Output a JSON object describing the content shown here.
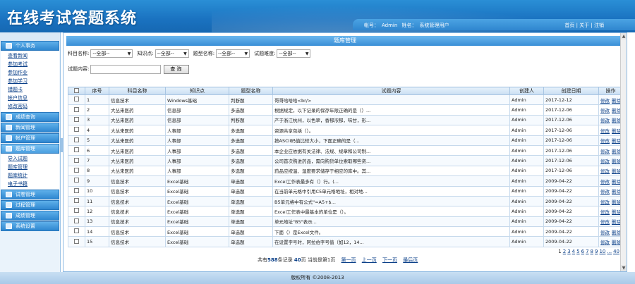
{
  "header": {
    "title": "在线考试答题系统",
    "account_label": "帐号：",
    "account": "Admin",
    "name_label": "姓名：",
    "name": "系统管理用户",
    "home": "首页",
    "about": "关于",
    "logout": "注销",
    "sep": "|"
  },
  "sidebar": {
    "groups": [
      {
        "label": "个人事务",
        "active": false,
        "items": [
          "查看新闻",
          "参加考试",
          "参加作业",
          "参加学习",
          "错题卡",
          "帐户信息",
          "修改密码"
        ]
      },
      {
        "label": "成绩查询",
        "active": false,
        "items": []
      },
      {
        "label": "新闻管理",
        "active": false,
        "items": []
      },
      {
        "label": "帐户管理",
        "active": false,
        "items": []
      },
      {
        "label": "题库管理",
        "active": true,
        "items": [
          "导入试题",
          "题库管理",
          "题库统计",
          "电子书籍"
        ]
      },
      {
        "label": "试卷管理",
        "active": false,
        "items": []
      },
      {
        "label": "过程管理",
        "active": false,
        "items": []
      },
      {
        "label": "成绩管理",
        "active": false,
        "items": []
      },
      {
        "label": "系统设置",
        "active": false,
        "items": []
      }
    ]
  },
  "main": {
    "panel_title": "题库管理",
    "filters": {
      "subject_label": "科目名称:",
      "subject_value": "--全部--",
      "point_label": "知识点:",
      "point_value": "--全部--",
      "qtype_label": "题型名称:",
      "qtype_value": "--全部--",
      "difficulty_label": "试题难度:",
      "difficulty_value": "--全部--",
      "content_label": "试题内容:",
      "content_value": "",
      "search_button": "查询"
    },
    "table": {
      "headers": [
        "",
        "序号",
        "科目名称",
        "知识点",
        "题型名称",
        "试题内容",
        "创建人",
        "创建日期",
        "操作"
      ],
      "rows": [
        [
          "1",
          "信息技术",
          "Windows基础",
          "判断题",
          "哥哥哈哈哈<br/>",
          "Admin",
          "2017-12-12"
        ],
        [
          "2",
          "大丛来医药",
          "信息部",
          "多选题",
          "根据规定，以下记录的保存年限正确的是（）...",
          "Admin",
          "2017-12-06"
        ],
        [
          "3",
          "大丛来医药",
          "信息部",
          "判断题",
          "产于浙江杭州，以色翠，香郁浓郁，味甘，形...",
          "Admin",
          "2017-12-06"
        ],
        [
          "4",
          "大丛来医药",
          "人事部",
          "多选题",
          "资源共享包括（）。",
          "Admin",
          "2017-12-06"
        ],
        [
          "5",
          "大丛来医药",
          "人事部",
          "多选题",
          "按ASCII码值比较大小，下面正确的是（...",
          "Admin",
          "2017-12-06"
        ],
        [
          "6",
          "大丛来医药",
          "人事部",
          "多选题",
          "本企业应依据有关法律、法规、规章和公司制...",
          "Admin",
          "2017-12-06"
        ],
        [
          "7",
          "大丛来医药",
          "人事部",
          "多选题",
          "公司首次购进药品，需向购货单位索取哪些资...",
          "Admin",
          "2017-12-06"
        ],
        [
          "8",
          "大丛来医药",
          "人事部",
          "多选题",
          "药品应按温、湿度要求储存于相应的库中。其...",
          "Admin",
          "2017-12-06"
        ],
        [
          "9",
          "信息技术",
          "Excel基础",
          "单选题",
          "Excel工作表最多有（）行。(...",
          "Admin",
          "2009-04-22"
        ],
        [
          "10",
          "信息技术",
          "Excel基础",
          "单选题",
          "在当前单元格中引用C5单元格地址，相对地...",
          "Admin",
          "2009-04-22"
        ],
        [
          "11",
          "信息技术",
          "Excel基础",
          "单选题",
          "B5单元格中有公式\"=A5+$...",
          "Admin",
          "2009-04-22"
        ],
        [
          "12",
          "信息技术",
          "Excel基础",
          "单选题",
          "Excel工作表中最基本的单位是（）。",
          "Admin",
          "2009-04-22"
        ],
        [
          "13",
          "信息技术",
          "Excel基础",
          "单选题",
          "单元地址\"B5\"表示...",
          "Admin",
          "2009-04-22"
        ],
        [
          "14",
          "信息技术",
          "Excel基础",
          "单选题",
          "下面（）是Excel文件。",
          "Admin",
          "2009-04-22"
        ],
        [
          "15",
          "信息技术",
          "Excel基础",
          "单选题",
          "在设置字号时，阿拉伯字号值（如12，14...",
          "Admin",
          "2009-04-22"
        ]
      ],
      "op_edit": "修改",
      "op_delete": "删除"
    },
    "pager": {
      "pages": [
        "1",
        "2",
        "3",
        "4",
        "5",
        "6",
        "7",
        "8",
        "9",
        "10",
        "...",
        "40"
      ],
      "current": "1",
      "text_pre": "共有",
      "total_records": "588",
      "text_mid1": "条记录",
      "total_pages": "40",
      "text_mid2": "页 当前是第",
      "current_page": "1",
      "text_mid3": "页",
      "first": "第一页",
      "prev": "上一页",
      "next": "下一页",
      "last": "最后页"
    }
  },
  "footer": {
    "copyright": "版权所有 ©2008-2013"
  }
}
